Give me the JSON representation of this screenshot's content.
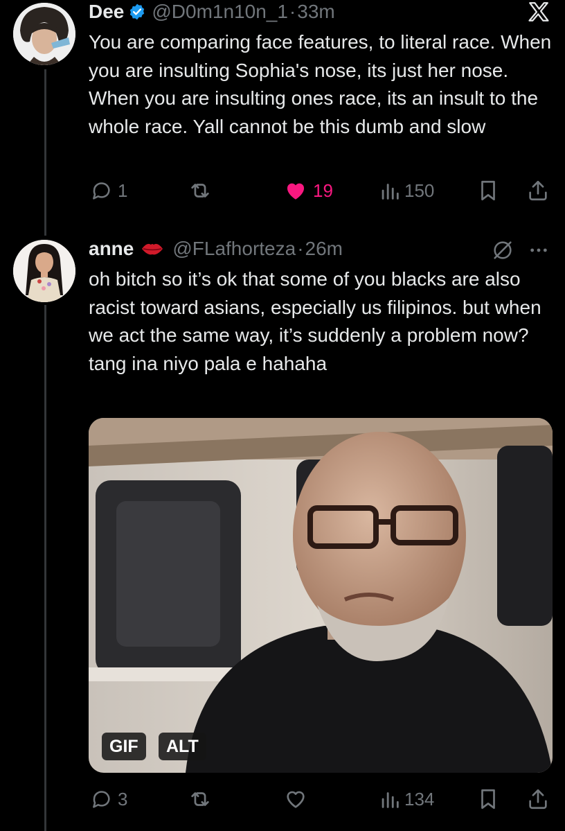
{
  "tweets": [
    {
      "author_name": "Dee",
      "verified": true,
      "handle": "@D0m1n10n_1",
      "separator": "·",
      "time": "33m",
      "text": "You are comparing face features, to literal race. When you are insulting Sophia's nose, its just her nose. When you are insulting ones race, its an insult to the whole race. Yall cannot be this dumb and slow",
      "replies": "1",
      "likes": "19",
      "liked": true,
      "views": "150"
    },
    {
      "author_name": "anne",
      "name_emoji": "lips-kiss-icon",
      "handle": "@FLafhorteza",
      "separator": "·",
      "time": "26m",
      "text": "oh bitch so it’s ok that some of you blacks are also racist toward asians,  especially us filipinos. but when we act the same way, it’s suddenly a problem now? tang ina niyo pala e hahaha",
      "media": {
        "gif_badge": "GIF",
        "alt_badge": "ALT"
      },
      "replies": "3",
      "likes": "",
      "liked": false,
      "views": "134"
    }
  ],
  "colors": {
    "background": "#000000",
    "text": "#e7e9ea",
    "muted": "#71767b",
    "like_active": "#f91880",
    "verified": "#1d9bf0"
  }
}
